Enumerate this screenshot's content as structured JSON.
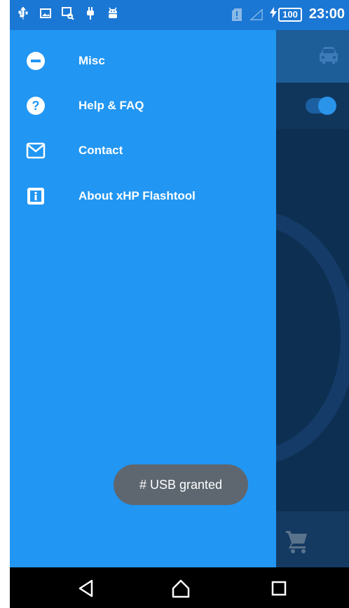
{
  "status_bar": {
    "battery": "100",
    "time": "23:00",
    "icons": [
      "usb-icon",
      "image-icon",
      "screen-search-icon",
      "charging-plug-icon",
      "android-debug-icon",
      "sim-alert-icon",
      "signal-icon",
      "charging-bolt-icon"
    ]
  },
  "drawer": {
    "items": [
      {
        "label": "Misc",
        "icon": "minus-circle-icon"
      },
      {
        "label": "Help & FAQ",
        "icon": "help-circle-icon"
      },
      {
        "label": "Contact",
        "icon": "mail-icon"
      },
      {
        "label": "About xHP Flashtool",
        "icon": "info-icon"
      }
    ]
  },
  "toast": {
    "text": "# USB granted"
  },
  "background_app": {
    "toolbar_icon": "car-icon",
    "bottom_icon": "shopping-cart-icon"
  },
  "colors": {
    "drawer": "#2196f3",
    "status_bar": "#1b77d4",
    "background": "#0d2f52",
    "toast": "#5e6770"
  },
  "nav_bar": {
    "buttons": [
      "back-icon",
      "home-icon",
      "recents-icon"
    ]
  }
}
